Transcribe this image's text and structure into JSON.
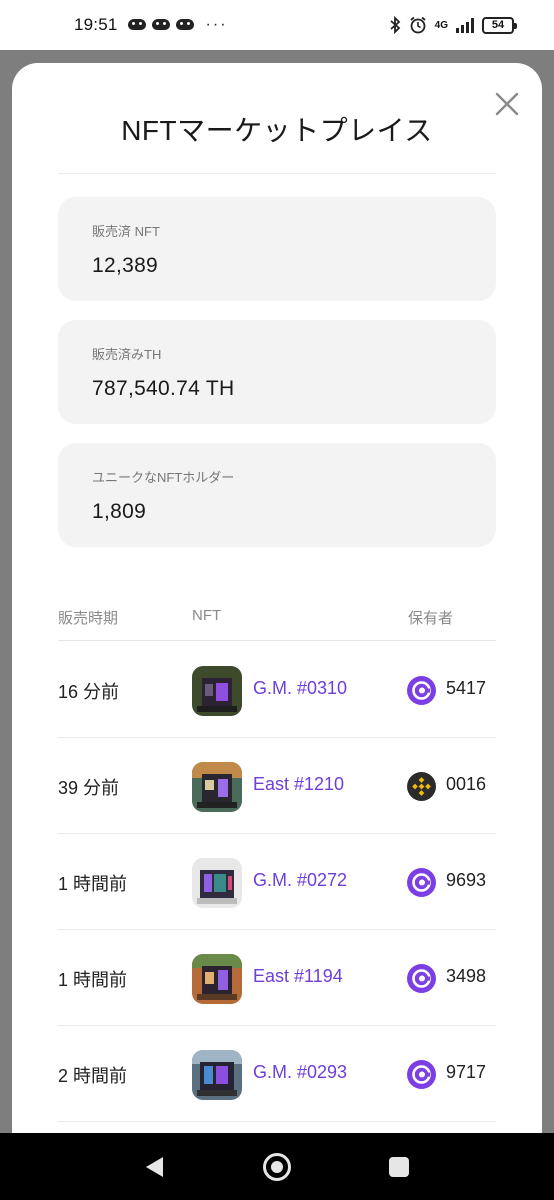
{
  "status_bar": {
    "time": "19:51",
    "more": "···",
    "network": "4G",
    "battery": "54"
  },
  "sheet": {
    "title": "NFTマーケットプレイス",
    "stats": [
      {
        "label": "販売済 NFT",
        "value": "12,389"
      },
      {
        "label": "販売済みTH",
        "value": "787,540.74 TH"
      },
      {
        "label": "ユニークなNFTホルダー",
        "value": "1,809"
      }
    ],
    "table": {
      "headers": {
        "time": "販売時期",
        "nft": "NFT",
        "owner": "保有者"
      },
      "rows": [
        {
          "time": "16 分前",
          "nft": "G.M. #0310",
          "owner": "5417",
          "owner_icon": "gm-coin-icon",
          "thumb": "purple"
        },
        {
          "time": "39 分前",
          "nft": "East #1210",
          "owner": "0016",
          "owner_icon": "bnb-icon",
          "thumb": "orange"
        },
        {
          "time": "1 時間前",
          "nft": "G.M. #0272",
          "owner": "9693",
          "owner_icon": "gm-coin-icon",
          "thumb": "white"
        },
        {
          "time": "1 時間前",
          "nft": "East #1194",
          "owner": "3498",
          "owner_icon": "gm-coin-icon",
          "thumb": "brown"
        },
        {
          "time": "2 時間前",
          "nft": "G.M. #0293",
          "owner": "9717",
          "owner_icon": "gm-coin-icon",
          "thumb": "teal"
        }
      ]
    }
  },
  "colors": {
    "accent": "#6d3fd8",
    "gm_coin": "#7b3fe4",
    "bnb_bg": "#2b2b2b",
    "bnb_fg": "#f0b90b",
    "card_bg": "#f3f3f3"
  }
}
